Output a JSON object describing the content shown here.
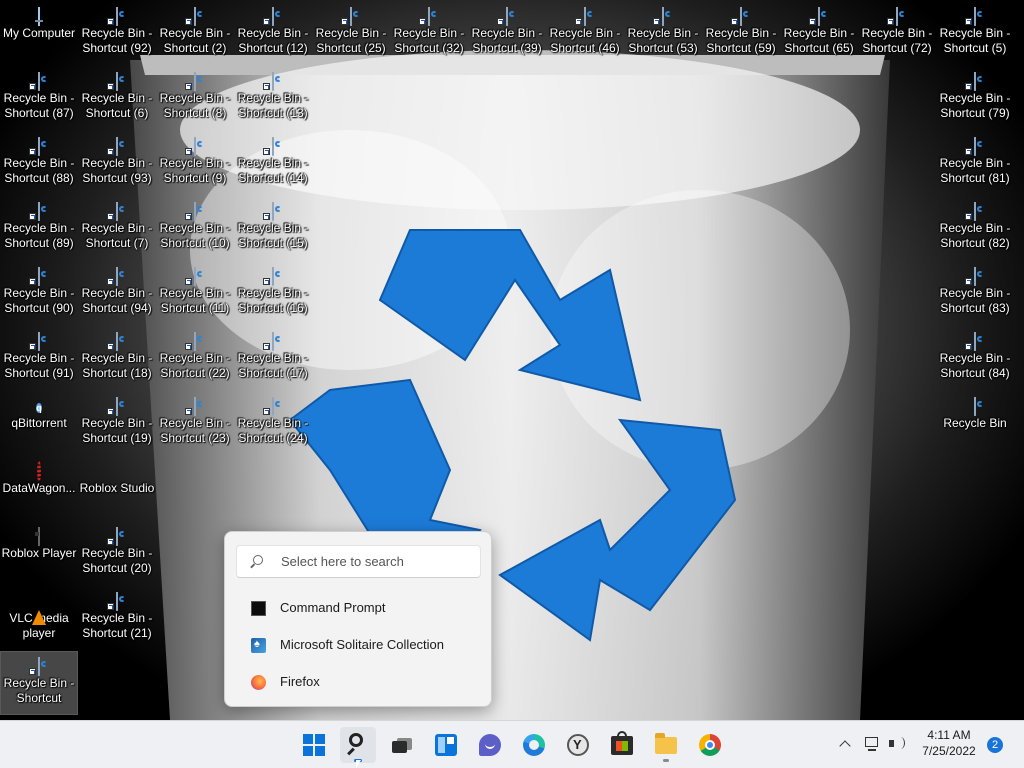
{
  "desktop": {
    "icons": [
      {
        "label": "My Computer",
        "icon": "computer-icon",
        "col": 0,
        "row": 0
      },
      {
        "label": "Recycle Bin -\nShortcut (87)",
        "icon": "recycle-bin-shortcut-icon",
        "col": 0,
        "row": 1
      },
      {
        "label": "Recycle Bin -\nShortcut (88)",
        "icon": "recycle-bin-shortcut-icon",
        "col": 0,
        "row": 2
      },
      {
        "label": "Recycle Bin -\nShortcut (89)",
        "icon": "recycle-bin-shortcut-icon",
        "col": 0,
        "row": 3
      },
      {
        "label": "Recycle Bin -\nShortcut (90)",
        "icon": "recycle-bin-shortcut-icon",
        "col": 0,
        "row": 4
      },
      {
        "label": "Recycle Bin -\nShortcut (91)",
        "icon": "recycle-bin-shortcut-icon",
        "col": 0,
        "row": 5
      },
      {
        "label": "qBittorrent",
        "icon": "qbittorrent-icon",
        "col": 0,
        "row": 6
      },
      {
        "label": "DataWagon...",
        "icon": "datawagon-icon",
        "col": 0,
        "row": 7
      },
      {
        "label": "Roblox Player",
        "icon": "roblox-player-icon",
        "col": 0,
        "row": 8
      },
      {
        "label": "VLC media\nplayer",
        "icon": "vlc-icon",
        "col": 0,
        "row": 9
      },
      {
        "label": "Recycle Bin -\nShortcut",
        "icon": "recycle-bin-shortcut-icon",
        "col": 0,
        "row": 10,
        "selected": true
      },
      {
        "label": "Recycle Bin -\nShortcut (92)",
        "icon": "recycle-bin-shortcut-icon",
        "col": 1,
        "row": 0
      },
      {
        "label": "Recycle Bin -\nShortcut (6)",
        "icon": "recycle-bin-shortcut-icon",
        "col": 1,
        "row": 1
      },
      {
        "label": "Recycle Bin -\nShortcut (93)",
        "icon": "recycle-bin-shortcut-icon",
        "col": 1,
        "row": 2
      },
      {
        "label": "Recycle Bin -\nShortcut (7)",
        "icon": "recycle-bin-shortcut-icon",
        "col": 1,
        "row": 3
      },
      {
        "label": "Recycle Bin -\nShortcut (94)",
        "icon": "recycle-bin-shortcut-icon",
        "col": 1,
        "row": 4
      },
      {
        "label": "Recycle Bin -\nShortcut (18)",
        "icon": "recycle-bin-shortcut-icon",
        "col": 1,
        "row": 5
      },
      {
        "label": "Recycle Bin -\nShortcut (19)",
        "icon": "recycle-bin-shortcut-icon",
        "col": 1,
        "row": 6
      },
      {
        "label": "Roblox Studio",
        "icon": "roblox-studio-icon",
        "col": 1,
        "row": 7
      },
      {
        "label": "Recycle Bin -\nShortcut (20)",
        "icon": "recycle-bin-shortcut-icon",
        "col": 1,
        "row": 8
      },
      {
        "label": "Recycle Bin -\nShortcut (21)",
        "icon": "recycle-bin-shortcut-icon",
        "col": 1,
        "row": 9
      },
      {
        "label": "Recycle Bin -\nShortcut (2)",
        "icon": "recycle-bin-shortcut-icon",
        "col": 2,
        "row": 0
      },
      {
        "label": "Recycle Bin -\nShortcut (8)",
        "icon": "recycle-bin-shortcut-icon",
        "col": 2,
        "row": 1
      },
      {
        "label": "Recycle Bin -\nShortcut (9)",
        "icon": "recycle-bin-shortcut-icon",
        "col": 2,
        "row": 2
      },
      {
        "label": "Recycle Bin -\nShortcut (10)",
        "icon": "recycle-bin-shortcut-icon",
        "col": 2,
        "row": 3
      },
      {
        "label": "Recycle Bin -\nShortcut (11)",
        "icon": "recycle-bin-shortcut-icon",
        "col": 2,
        "row": 4
      },
      {
        "label": "Recycle Bin -\nShortcut (22)",
        "icon": "recycle-bin-shortcut-icon",
        "col": 2,
        "row": 5
      },
      {
        "label": "Recycle Bin -\nShortcut (23)",
        "icon": "recycle-bin-shortcut-icon",
        "col": 2,
        "row": 6
      },
      {
        "label": "Recycle Bin -\nShortcut (12)",
        "icon": "recycle-bin-shortcut-icon",
        "col": 3,
        "row": 0
      },
      {
        "label": "Recycle Bin -\nShortcut (13)",
        "icon": "recycle-bin-shortcut-icon",
        "col": 3,
        "row": 1
      },
      {
        "label": "Recycle Bin -\nShortcut (14)",
        "icon": "recycle-bin-shortcut-icon",
        "col": 3,
        "row": 2
      },
      {
        "label": "Recycle Bin -\nShortcut (15)",
        "icon": "recycle-bin-shortcut-icon",
        "col": 3,
        "row": 3
      },
      {
        "label": "Recycle Bin -\nShortcut (16)",
        "icon": "recycle-bin-shortcut-icon",
        "col": 3,
        "row": 4
      },
      {
        "label": "Recycle Bin -\nShortcut (17)",
        "icon": "recycle-bin-shortcut-icon",
        "col": 3,
        "row": 5
      },
      {
        "label": "Recycle Bin -\nShortcut (24)",
        "icon": "recycle-bin-shortcut-icon",
        "col": 3,
        "row": 6
      },
      {
        "label": "Recycle Bin -\nShortcut (25)",
        "icon": "recycle-bin-shortcut-icon",
        "col": 4,
        "row": 0
      },
      {
        "label": "Recycle Bin -\nShortcut (32)",
        "icon": "recycle-bin-shortcut-icon",
        "col": 5,
        "row": 0
      },
      {
        "label": "Recycle Bin -\nShortcut (39)",
        "icon": "recycle-bin-shortcut-icon",
        "col": 6,
        "row": 0
      },
      {
        "label": "Recycle Bin -\nShortcut (46)",
        "icon": "recycle-bin-shortcut-icon",
        "col": 7,
        "row": 0
      },
      {
        "label": "Recycle Bin -\nShortcut (53)",
        "icon": "recycle-bin-shortcut-icon",
        "col": 8,
        "row": 0
      },
      {
        "label": "Recycle Bin -\nShortcut (59)",
        "icon": "recycle-bin-shortcut-icon",
        "col": 9,
        "row": 0
      },
      {
        "label": "Recycle Bin -\nShortcut (65)",
        "icon": "recycle-bin-shortcut-icon",
        "col": 10,
        "row": 0
      },
      {
        "label": "Recycle Bin -\nShortcut (72)",
        "icon": "recycle-bin-shortcut-icon",
        "col": 11,
        "row": 0
      },
      {
        "label": "Recycle Bin -\nShortcut (5)",
        "icon": "recycle-bin-shortcut-icon",
        "col": 12,
        "row": 0
      },
      {
        "label": "Recycle Bin -\nShortcut (79)",
        "icon": "recycle-bin-shortcut-icon",
        "col": 12,
        "row": 1
      },
      {
        "label": "Recycle Bin -\nShortcut (81)",
        "icon": "recycle-bin-shortcut-icon",
        "col": 12,
        "row": 2
      },
      {
        "label": "Recycle Bin -\nShortcut (82)",
        "icon": "recycle-bin-shortcut-icon",
        "col": 12,
        "row": 3
      },
      {
        "label": "Recycle Bin -\nShortcut (83)",
        "icon": "recycle-bin-shortcut-icon",
        "col": 12,
        "row": 4
      },
      {
        "label": "Recycle Bin -\nShortcut (84)",
        "icon": "recycle-bin-shortcut-icon",
        "col": 12,
        "row": 5
      },
      {
        "label": "Recycle Bin",
        "icon": "recycle-bin-icon",
        "col": 12,
        "row": 6
      }
    ]
  },
  "search_flyout": {
    "placeholder": "Select here to search",
    "results": [
      {
        "label": "Command Prompt",
        "icon": "command-prompt-icon"
      },
      {
        "label": "Microsoft Solitaire Collection",
        "icon": "solitaire-icon"
      },
      {
        "label": "Firefox",
        "icon": "firefox-icon"
      }
    ]
  },
  "taskbar": {
    "buttons": [
      {
        "name": "start-button",
        "icon": "windows-start-icon",
        "state": "normal"
      },
      {
        "name": "search-button",
        "icon": "search-icon",
        "state": "active"
      },
      {
        "name": "task-view-button",
        "icon": "task-view-icon",
        "state": "normal"
      },
      {
        "name": "widgets-button",
        "icon": "widgets-icon",
        "state": "normal"
      },
      {
        "name": "chat-button",
        "icon": "chat-icon",
        "state": "normal"
      },
      {
        "name": "edge-button",
        "icon": "edge-icon",
        "state": "normal"
      },
      {
        "name": "yandex-button",
        "icon": "yandex-browser-icon",
        "state": "normal"
      },
      {
        "name": "store-button",
        "icon": "microsoft-store-icon",
        "state": "normal"
      },
      {
        "name": "file-explorer-button",
        "icon": "folder-icon",
        "state": "running"
      },
      {
        "name": "chrome-button",
        "icon": "chrome-icon",
        "state": "normal"
      }
    ],
    "clock": {
      "time": "4:11 AM",
      "date": "7/25/2022"
    },
    "notification_count": "2",
    "accent_color": "#1a73d9"
  }
}
